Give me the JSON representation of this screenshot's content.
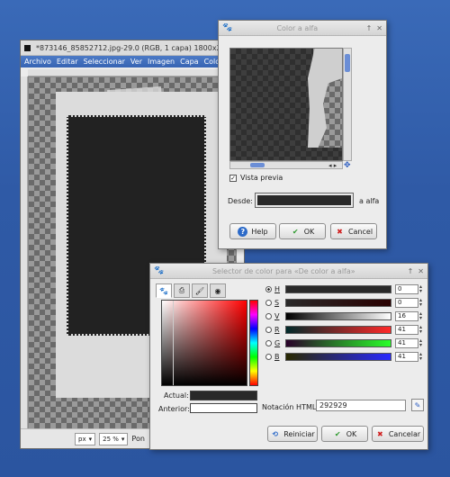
{
  "gimp": {
    "title": "*873146_85852712.jpg-29.0 (RGB, 1 capa) 1800x24",
    "menu": [
      "Archivo",
      "Editar",
      "Seleccionar",
      "Ver",
      "Imagen",
      "Capa",
      "Colores"
    ],
    "status": {
      "unit": "px",
      "zoom": "25 %",
      "label": "Pon"
    }
  },
  "color_to_alpha": {
    "title": "Color a alfa",
    "preview_label": "Vista previa",
    "preview_checked": true,
    "from_label": "Desde:",
    "from_color": "#292929",
    "to_label": "a alfa",
    "buttons": {
      "help": "Help",
      "ok": "OK",
      "cancel": "Cancel"
    }
  },
  "color_selector": {
    "title": "Selector de color para «De color a alfa»",
    "sliders": [
      {
        "label": "H",
        "value": "0",
        "selected": true
      },
      {
        "label": "S",
        "value": "0",
        "selected": false
      },
      {
        "label": "V",
        "value": "16",
        "selected": false
      },
      {
        "label": "R",
        "value": "41",
        "selected": false
      },
      {
        "label": "G",
        "value": "41",
        "selected": false
      },
      {
        "label": "B",
        "value": "41",
        "selected": false
      }
    ],
    "actual_label": "Actual:",
    "previous_label": "Anterior:",
    "html_label": "Notación HTML:",
    "html_value": "292929",
    "buttons": {
      "reset": "Reiniciar",
      "ok": "OK",
      "cancel": "Cancelar"
    }
  }
}
